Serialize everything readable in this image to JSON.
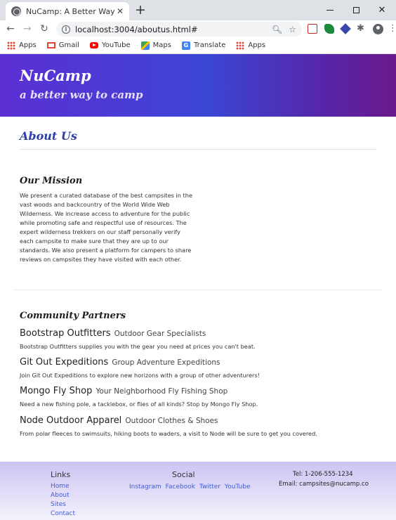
{
  "browser": {
    "tab_title": "NuCamp: A Better Way To Camp",
    "tab_close": "✕",
    "new_tab": "+",
    "url": "localhost:3004/aboutus.html#",
    "bookmarks": [
      {
        "label": "Apps",
        "icon": "apps-icon"
      },
      {
        "label": "Gmail",
        "icon": "gmail-icon"
      },
      {
        "label": "YouTube",
        "icon": "youtube-icon"
      },
      {
        "label": "Maps",
        "icon": "maps-icon"
      },
      {
        "label": "Translate",
        "icon": "translate-icon"
      },
      {
        "label": "Apps",
        "icon": "apps-icon"
      }
    ]
  },
  "header": {
    "brand": "NuCamp",
    "tagline": "a better way to camp"
  },
  "about": {
    "title": "About Us"
  },
  "mission": {
    "heading": "Our Mission",
    "lines": [
      "We present a curated database of the best campsites in the",
      "vast woods and backcountry of the World Wide Web",
      "Wilderness. We increase access to adventure for the public",
      "while promoting safe and respectful use of resources. The",
      "expert wilderness trekkers on our staff personally verify",
      "each campsite to make sure that they are up to our",
      "standards. We also present a platform for campers to share",
      "reviews on campsites they have visited with each other."
    ]
  },
  "partners": {
    "heading": "Community Partners",
    "items": [
      {
        "name": "Bootstrap Outfitters",
        "desc": "Outdoor Gear Specialists",
        "text": "Bootstrap Outfitters supplies you with the gear you need at prices you can't beat."
      },
      {
        "name": "Git Out Expeditions",
        "desc": "Group Adventure Expeditions",
        "text": "Join Git Out Expeditions to explore new horizons with a group of other adventurers!"
      },
      {
        "name": "Mongo Fly Shop",
        "desc": "Your Neighborhood Fly Fishing Shop",
        "text": "Need a new fishing pole, a tacklebox, or flies of all kinds? Stop by Mongo Fly Shop."
      },
      {
        "name": "Node Outdoor Apparel",
        "desc": "Outdoor Clothes & Shoes",
        "text": "From polar fleeces to swimsuits, hiking boots to waders, a visit to Node will be sure to get you covered."
      }
    ]
  },
  "footer": {
    "links_heading": "Links",
    "links": [
      "Home",
      "About",
      "Sites",
      "Contact"
    ],
    "social_heading": "Social",
    "social": [
      "Instagram",
      "Facebook",
      "Twitter",
      "YouTube"
    ],
    "tel": "Tel: 1-206-555-1234",
    "email": "Email: campsites@nucamp.co"
  }
}
